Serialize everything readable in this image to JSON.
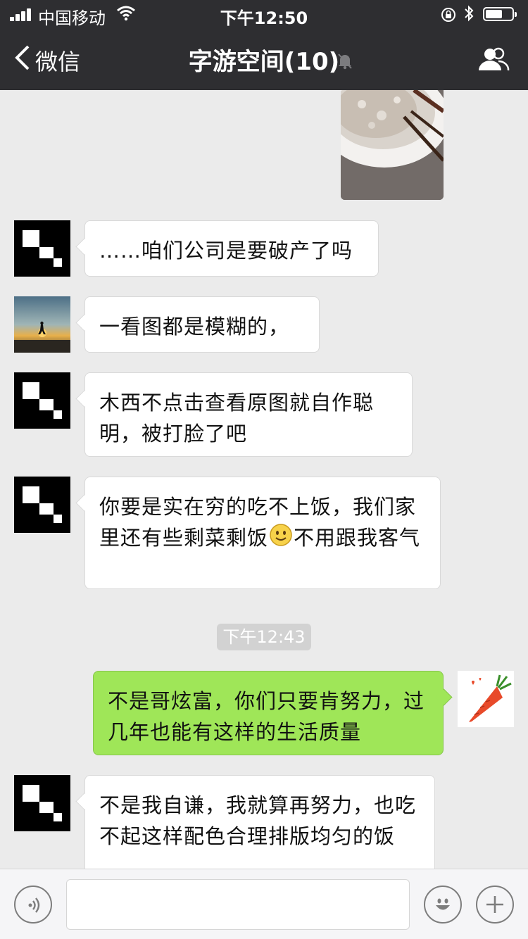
{
  "status_bar": {
    "carrier": "中国移动",
    "time": "下午12:50",
    "battery_level": 0.65
  },
  "nav": {
    "back_label": "微信",
    "title": "字游空间(10)"
  },
  "messages": [
    {
      "side": "left",
      "avatar": "qr-block-avatar",
      "text": "……咱们公司是要破产了吗"
    },
    {
      "side": "left",
      "avatar": "sunset-avatar",
      "text": "一看图都是模糊的，"
    },
    {
      "side": "left",
      "avatar": "qr-block-avatar",
      "text": "木西不点击查看原图就自作聪明，被打脸了吧"
    },
    {
      "side": "left",
      "avatar": "qr-block-avatar",
      "text_before": "你要是实在穷的吃不上饭，我们家里还有些剩菜剩饭",
      "emoji": "smile-emoji",
      "text_after": "不用跟我客气"
    },
    {
      "side": "right",
      "avatar": "carrot-avatar",
      "text": "不是哥炫富，你们只要肯努力，过几年也能有这样的生活质量"
    },
    {
      "side": "left",
      "avatar": "qr-block-avatar",
      "text": "不是我自谦，我就算再努力，也吃不起这样配色合理排版均匀的饭"
    }
  ],
  "timestamp": "下午12:43",
  "input": {
    "value": "",
    "placeholder": ""
  },
  "colors": {
    "nav_bg": "#2e2e31",
    "chat_bg": "#ebebeb",
    "sent_bubble": "#9fe658",
    "received_bubble": "#ffffff"
  }
}
